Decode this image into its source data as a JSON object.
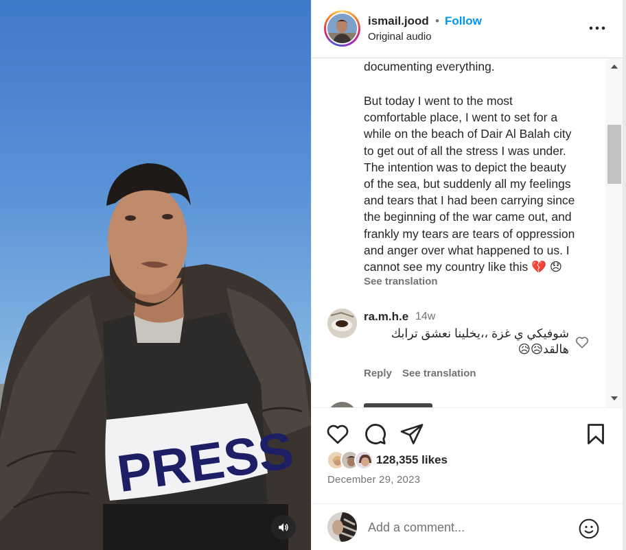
{
  "post": {
    "username": "ismail.jood",
    "separator": "•",
    "follow_label": "Follow",
    "audio_label": "Original audio"
  },
  "caption": {
    "first_line": "documenting everything.",
    "body": "But today I went to the most\ncomfortable place, I went to set for a\nwhile on the beach of Dair Al Balah city\nto get out of all the stress I was under.\nThe intention was to depict the beauty\nof the sea, but suddenly all my feelings\nand tears that I had been carrying since\nthe beginning of the war came out, and\nfrankly my tears are tears of oppression\nand anger over what happened to us. I\ncannot see my country like this 💔 😞",
    "see_translation": "See translation"
  },
  "comments": [
    {
      "username": "ra.m.h.e",
      "time": "14w",
      "text": "شوفيكي ي غزة ،،يخلينا نعشق ترابك هالقد😥😥",
      "reply_label": "Reply",
      "see_translation": "See translation"
    }
  ],
  "engagement": {
    "likes": "128,355 likes",
    "date": "December 29, 2023"
  },
  "add_comment": {
    "placeholder": "Add a comment..."
  },
  "media": {
    "shirt_text": "PRESS"
  },
  "colors": {
    "link_blue": "#0095f6",
    "text_primary": "#262626",
    "text_secondary": "#737373"
  }
}
